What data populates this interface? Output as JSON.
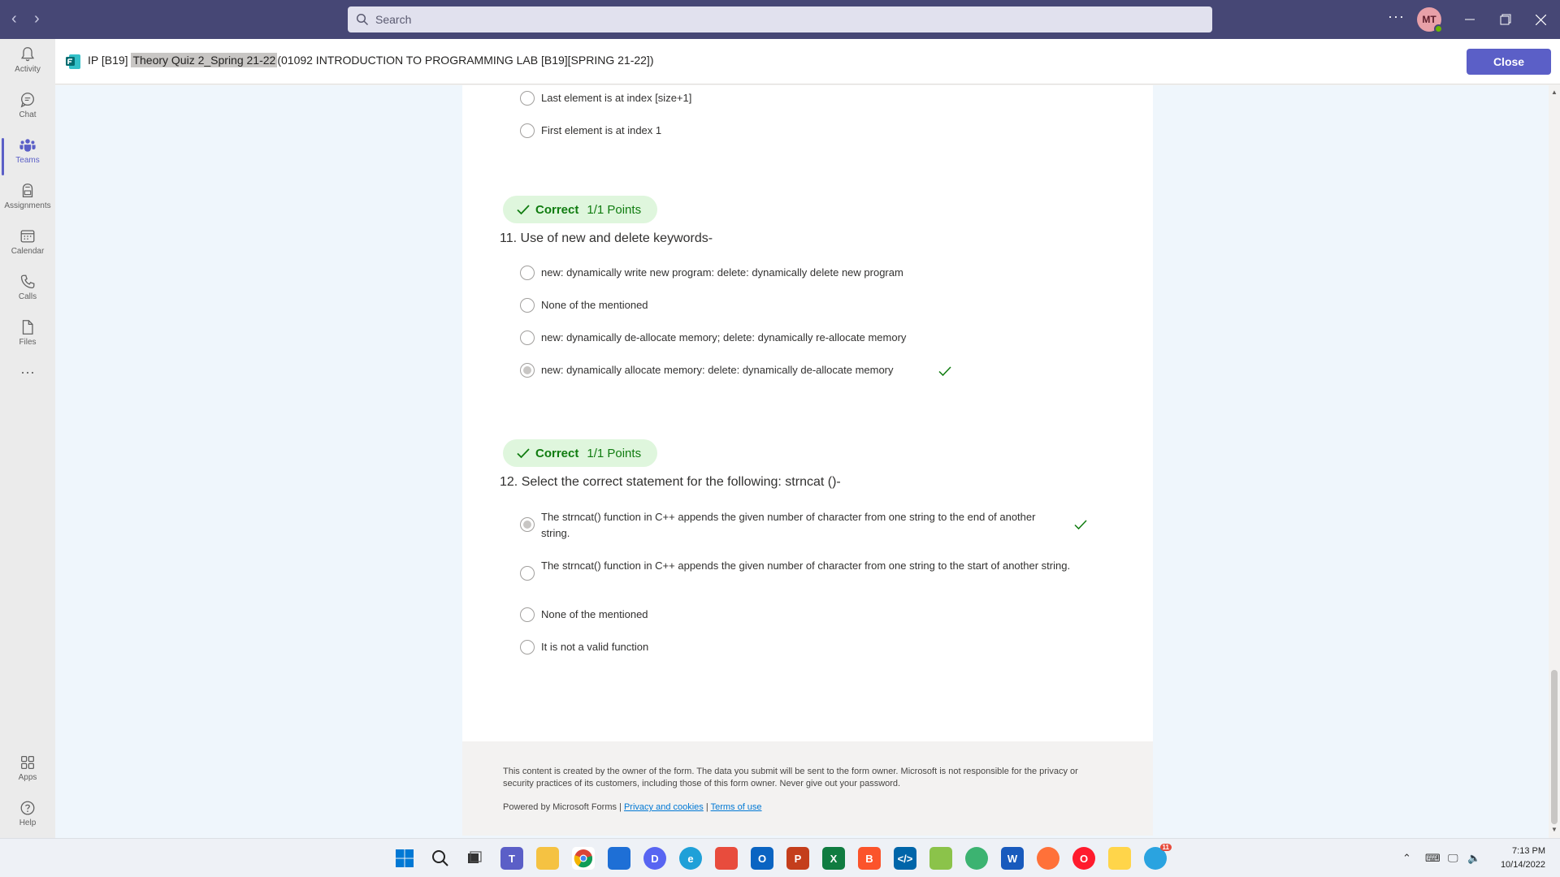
{
  "titlebar": {
    "search_placeholder": "Search",
    "avatar_initials": "MT"
  },
  "appbar": {
    "items": [
      {
        "label": "Activity",
        "icon": "bell-icon"
      },
      {
        "label": "Chat",
        "icon": "chat-icon"
      },
      {
        "label": "Teams",
        "icon": "teams-icon"
      },
      {
        "label": "Assignments",
        "icon": "assignments-icon"
      },
      {
        "label": "Calendar",
        "icon": "calendar-icon"
      },
      {
        "label": "Calls",
        "icon": "phone-icon"
      },
      {
        "label": "Files",
        "icon": "file-icon"
      },
      {
        "label": "Apps",
        "icon": "apps-icon"
      },
      {
        "label": "Help",
        "icon": "help-icon"
      }
    ],
    "more": "···"
  },
  "header": {
    "title_prefix": "IP [B19]",
    "title_highlight": "Theory Quiz 2_Spring 21-22",
    "title_suffix": "(01092 INTRODUCTION TO PROGRAMMING LAB [B19][SPRING 21-22])",
    "close_label": "Close"
  },
  "prev_question": {
    "options": [
      "Last element is at index [size+1]",
      "First element is at index 1"
    ]
  },
  "q11": {
    "status": "Correct",
    "points": "1/1 Points",
    "number": "11.",
    "text": "Use of new and delete keywords-",
    "options": [
      "new: dynamically write new program: delete: dynamically delete new program",
      "None of the mentioned",
      "new: dynamically de-allocate memory; delete: dynamically re-allocate memory",
      "new: dynamically allocate memory: delete: dynamically de-allocate memory"
    ],
    "selected_index": 3
  },
  "q12": {
    "status": "Correct",
    "points": "1/1 Points",
    "number": "12.",
    "text": "Select the correct statement for the following: strncat ()-",
    "options": [
      "The strncat() function in C++ appends the given number of character from one string to the end of another string.",
      "The strncat() function in C++ appends the given number of character from one string to the start of another string.",
      "None of the mentioned",
      "It is not a valid function"
    ],
    "selected_index": 0
  },
  "footer": {
    "disclaimer": "This content is created by the owner of the form. The data you submit will be sent to the form owner. Microsoft is not responsible for the privacy or security practices of its customers, including those of this form owner. Never give out your password.",
    "powered_by": "Powered by Microsoft Forms |",
    "privacy_link": "Privacy and cookies",
    "separator": "|",
    "terms_link": "Terms of use"
  },
  "taskbar": {
    "time": "7:13 PM",
    "date": "10/14/2022",
    "notification_badge": "11"
  },
  "colors": {
    "teams_purple": "#464775",
    "accent": "#5b5fc7",
    "correct_green": "#107c10",
    "correct_bg": "#dff6dd"
  }
}
